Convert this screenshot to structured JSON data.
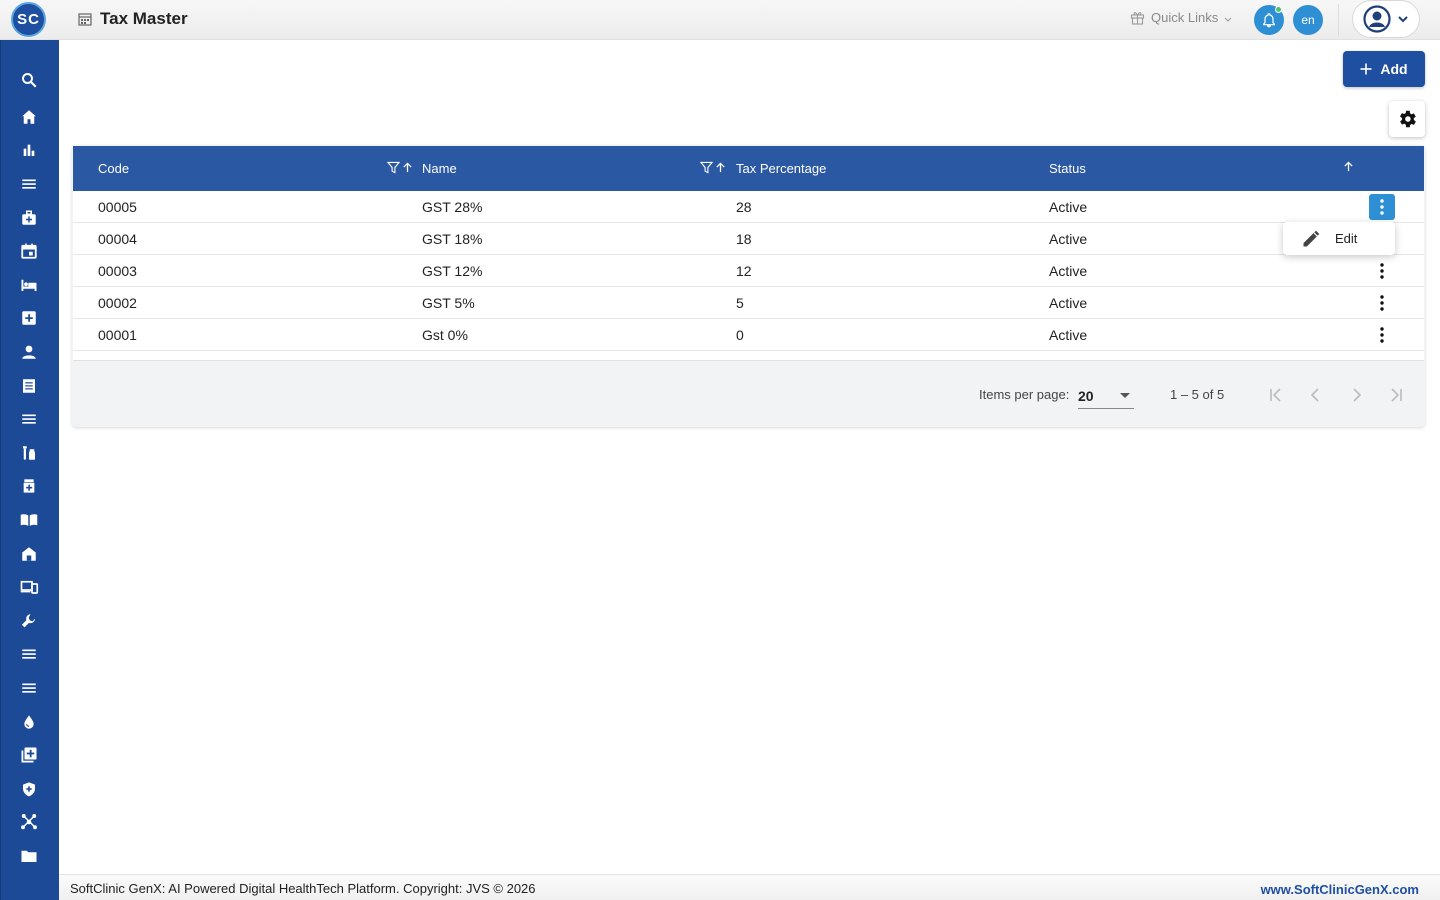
{
  "app": {
    "logo_text": "SC",
    "page_title": "Tax Master"
  },
  "header": {
    "quick_links_label": "Quick Links",
    "language": "en"
  },
  "sidebar": {
    "items": [
      {
        "icon": "search-icon"
      },
      {
        "icon": "home-icon"
      },
      {
        "icon": "bar-chart-icon"
      },
      {
        "icon": "menu-icon"
      },
      {
        "icon": "medical-bag-icon"
      },
      {
        "icon": "calendar-icon"
      },
      {
        "icon": "bed-icon"
      },
      {
        "icon": "plus-box-icon"
      },
      {
        "icon": "person-icon"
      },
      {
        "icon": "receipt-icon"
      },
      {
        "icon": "menu-icon"
      },
      {
        "icon": "lab-tubes-icon"
      },
      {
        "icon": "medicine-bottle-icon"
      },
      {
        "icon": "book-icon"
      },
      {
        "icon": "store-icon"
      },
      {
        "icon": "devices-icon"
      },
      {
        "icon": "wrench-icon"
      },
      {
        "icon": "menu-icon"
      },
      {
        "icon": "menu-icon"
      },
      {
        "icon": "blood-drop-icon"
      },
      {
        "icon": "add-library-icon"
      },
      {
        "icon": "shield-icon"
      },
      {
        "icon": "network-icon"
      },
      {
        "icon": "folder-icon"
      }
    ]
  },
  "toolbar": {
    "add_label": "Add"
  },
  "table": {
    "columns": [
      "Code",
      "Name",
      "Tax Percentage",
      "Status"
    ],
    "rows": [
      {
        "code": "00005",
        "name": "GST 28%",
        "tax": "28",
        "status": "Active"
      },
      {
        "code": "00004",
        "name": "GST 18%",
        "tax": "18",
        "status": "Active"
      },
      {
        "code": "00003",
        "name": "GST 12%",
        "tax": "12",
        "status": "Active"
      },
      {
        "code": "00002",
        "name": "GST 5%",
        "tax": "5",
        "status": "Active"
      },
      {
        "code": "00001",
        "name": "Gst 0%",
        "tax": "0",
        "status": "Active"
      }
    ]
  },
  "row_menu": {
    "edit_label": "Edit"
  },
  "paginator": {
    "items_per_page_label": "Items per page:",
    "items_per_page": "20",
    "range": "1 – 5 of 5"
  },
  "footer": {
    "copyright": "SoftClinic GenX: AI Powered Digital HealthTech Platform. Copyright: JVS © 2026",
    "website": "www.SoftClinicGenX.com"
  },
  "colors": {
    "primary": "#1e4fa0",
    "header_row": "#2a58a3",
    "accent": "#2f8fd5"
  }
}
